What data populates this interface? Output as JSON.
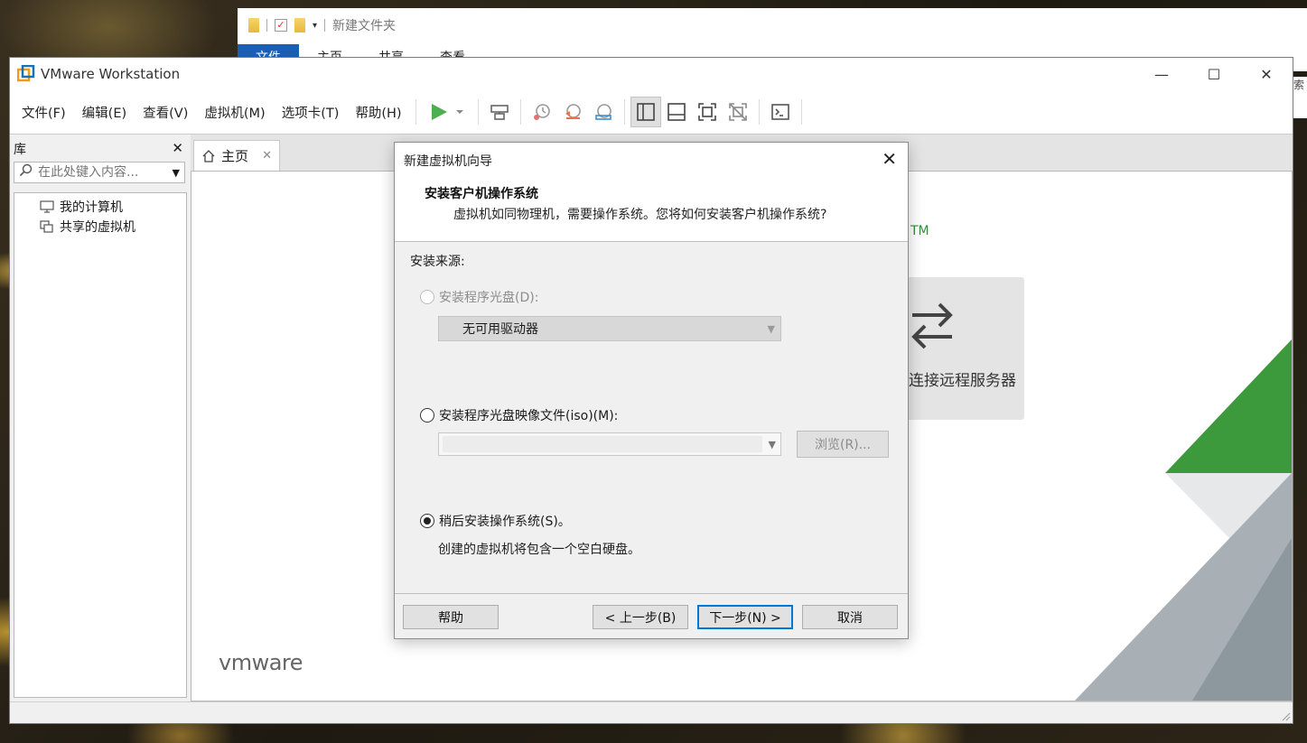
{
  "explorer": {
    "title": "新建文件夹",
    "tabs": [
      "文件",
      "主页",
      "共享",
      "查看"
    ],
    "side_text": "索"
  },
  "app": {
    "title": "VMware Workstation",
    "window_controls": {
      "minimize": "—",
      "maximize": "☐",
      "close": "✕"
    }
  },
  "menu": {
    "items": [
      "文件(F)",
      "编辑(E)",
      "查看(V)",
      "虚拟机(M)",
      "选项卡(T)",
      "帮助(H)"
    ]
  },
  "toolbar": {
    "icons": [
      "play-icon",
      "dropdown-icon",
      "send-ctrl-alt-del-icon",
      "snapshot-take-icon",
      "snapshot-revert-icon",
      "snapshot-manager-icon",
      "library-view-icon",
      "thumbnail-view-icon",
      "fullscreen-icon",
      "unity-icon",
      "console-view-icon"
    ]
  },
  "library": {
    "title": "库",
    "close": "✕",
    "search_placeholder": "在此处键入内容...",
    "tree": [
      {
        "label": "我的计算机",
        "icon": "computer-icon"
      },
      {
        "label": "共享的虚拟机",
        "icon": "shared-vm-icon"
      }
    ]
  },
  "tabs": {
    "home_label": "主页",
    "close": "✕"
  },
  "home": {
    "tm": "TM",
    "remote_label": "连接远程服务器",
    "brand": "vmware"
  },
  "dialog": {
    "title": "新建虚拟机向导",
    "close": "✕",
    "heading": "安装客户机操作系统",
    "subheading": "虚拟机如同物理机，需要操作系统。您将如何安装客户机操作系统?",
    "source_label": "安装来源:",
    "option_disc": "安装程序光盘(D):",
    "disc_select": "无可用驱动器",
    "option_iso": "安装程序光盘映像文件(iso)(M):",
    "iso_value": "",
    "browse": "浏览(R)...",
    "option_later": "稍后安装操作系统(S)。",
    "later_note": "创建的虚拟机将包含一个空白硬盘。",
    "selected_option": "later",
    "buttons": {
      "help": "帮助",
      "back": "< 上一步(B)",
      "next": "下一步(N) >",
      "cancel": "取消"
    }
  },
  "colors": {
    "vmware_green": "#3a8a3a",
    "focus_blue": "#0078d7",
    "ribbon_blue": "#1a5fb4"
  }
}
